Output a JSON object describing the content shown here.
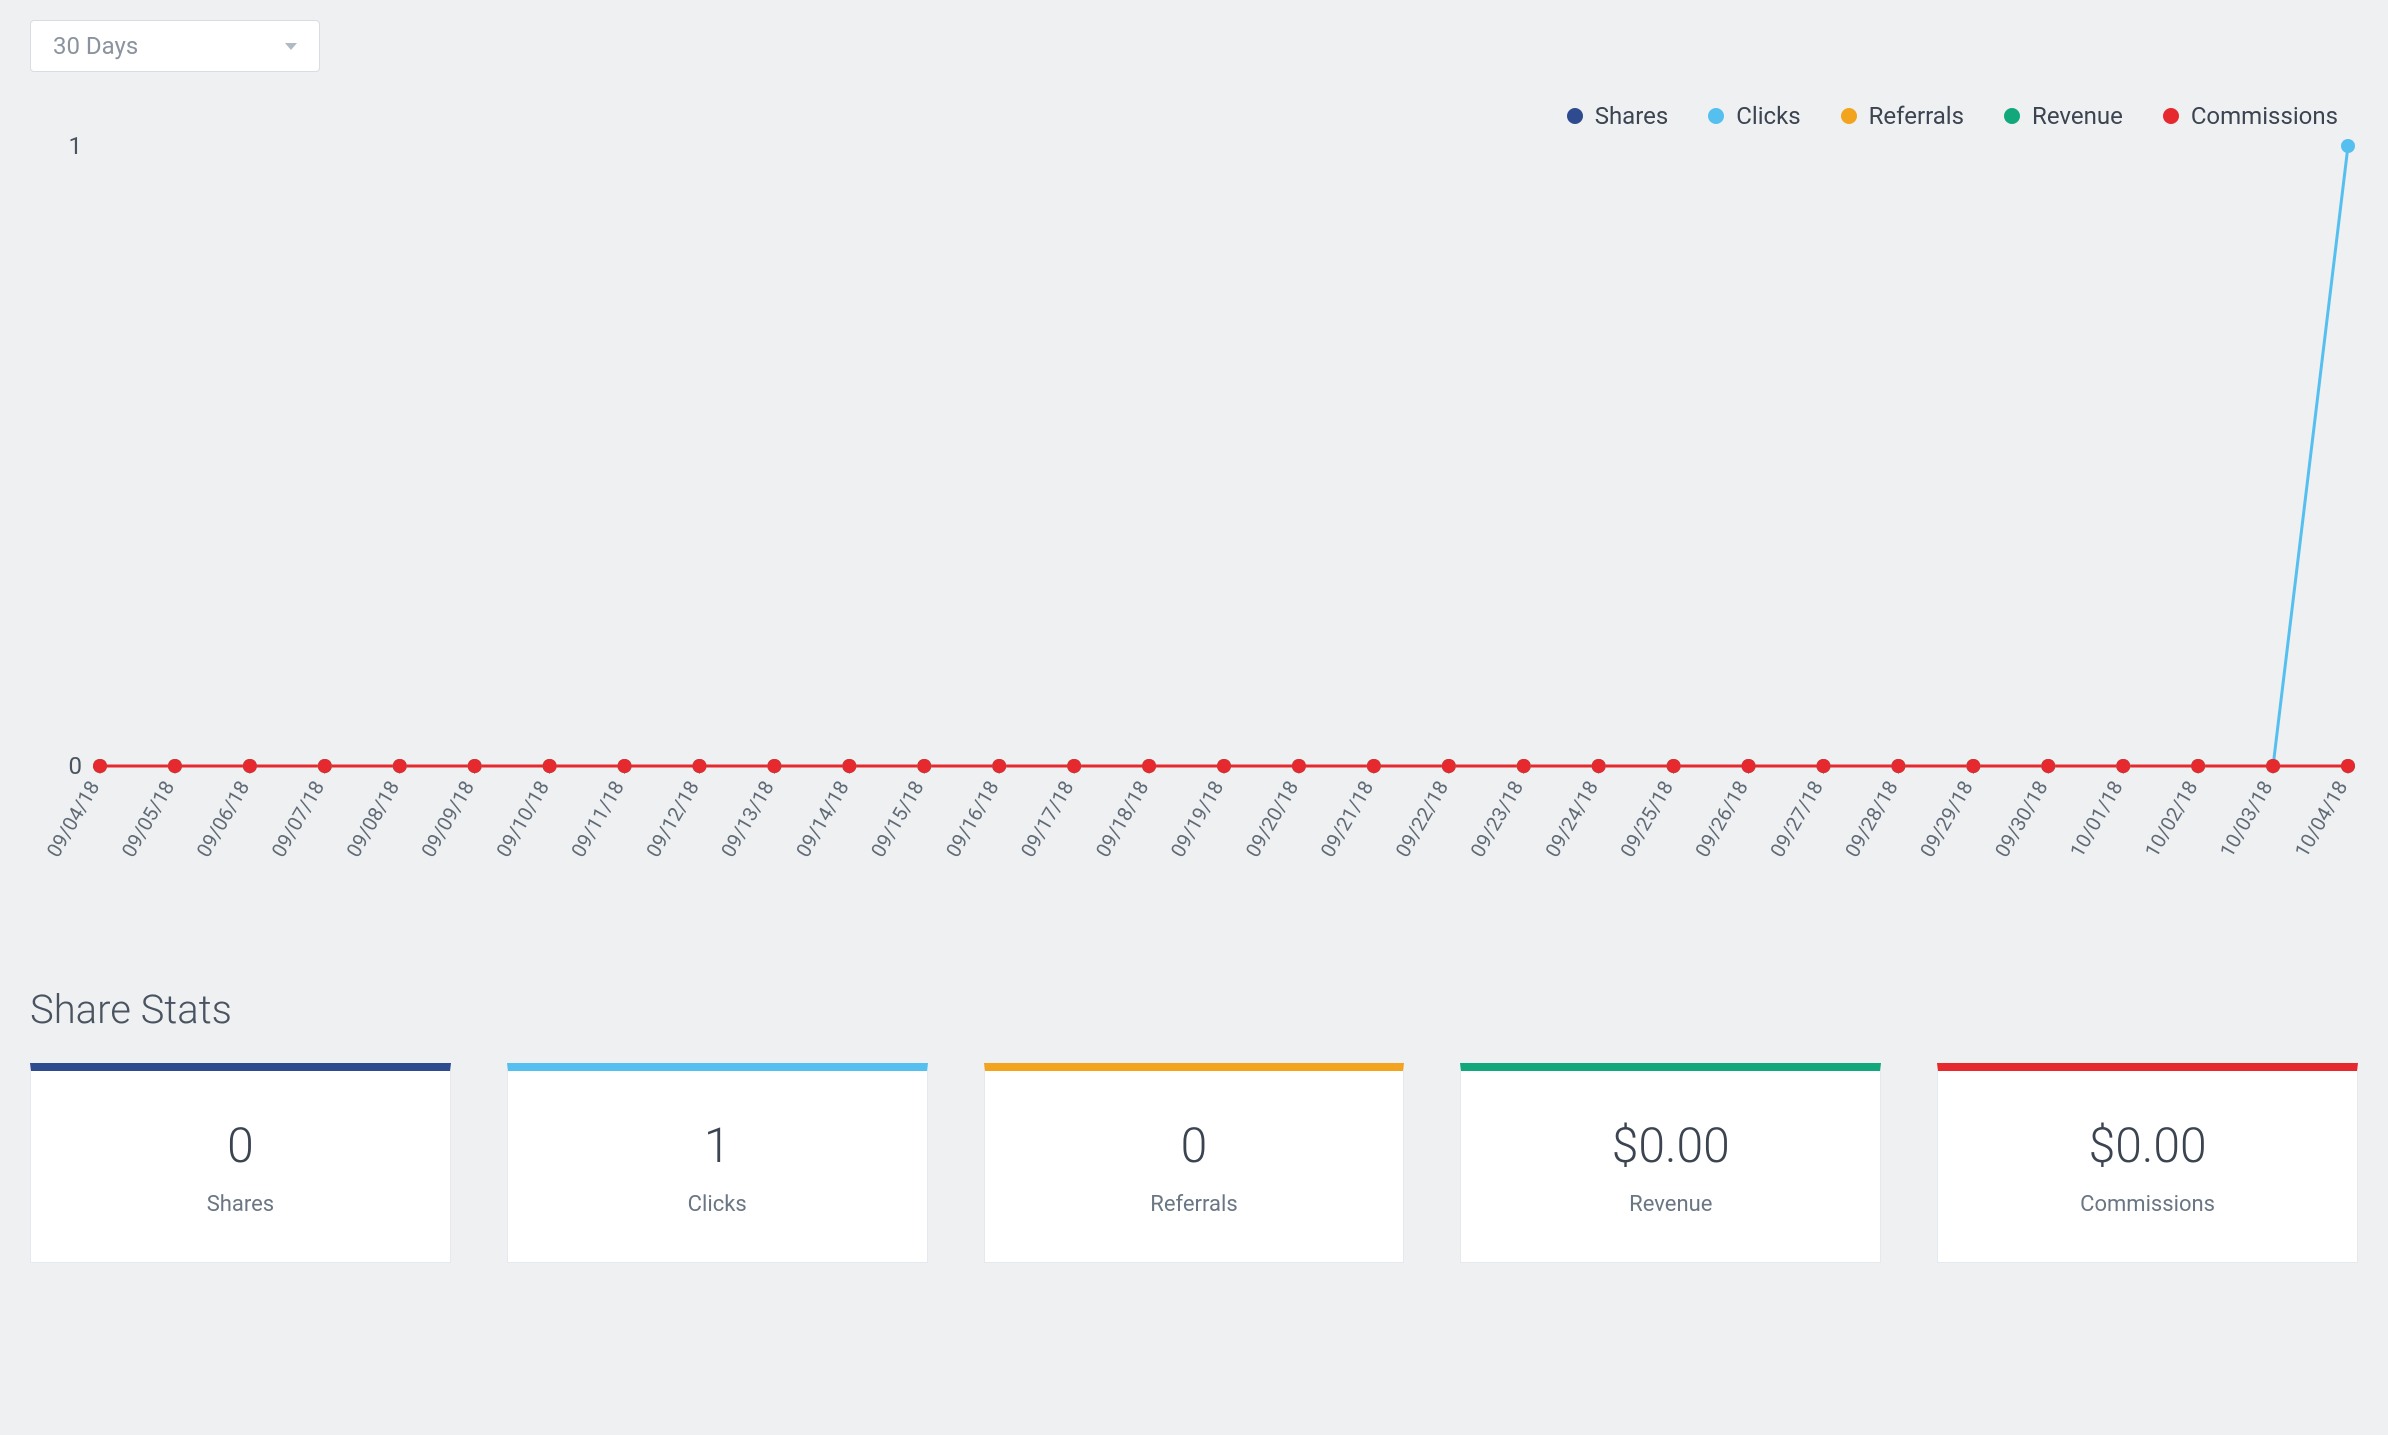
{
  "dropdown": {
    "selected": "30 Days"
  },
  "colors": {
    "shares": "#2f4b8f",
    "clicks": "#55bff0",
    "referrals": "#f2a41f",
    "revenue": "#12a87b",
    "commissions": "#e6292f"
  },
  "chart_data": {
    "type": "line",
    "xlabel": "",
    "ylabel": "",
    "ylim": [
      0,
      1
    ],
    "yticks": [
      0,
      1
    ],
    "categories": [
      "09/04/18",
      "09/05/18",
      "09/06/18",
      "09/07/18",
      "09/08/18",
      "09/09/18",
      "09/10/18",
      "09/11/18",
      "09/12/18",
      "09/13/18",
      "09/14/18",
      "09/15/18",
      "09/16/18",
      "09/17/18",
      "09/18/18",
      "09/19/18",
      "09/20/18",
      "09/21/18",
      "09/22/18",
      "09/23/18",
      "09/24/18",
      "09/25/18",
      "09/26/18",
      "09/27/18",
      "09/28/18",
      "09/29/18",
      "09/30/18",
      "10/01/18",
      "10/02/18",
      "10/03/18",
      "10/04/18"
    ],
    "series": [
      {
        "name": "Shares",
        "colorKey": "shares",
        "values": [
          0,
          0,
          0,
          0,
          0,
          0,
          0,
          0,
          0,
          0,
          0,
          0,
          0,
          0,
          0,
          0,
          0,
          0,
          0,
          0,
          0,
          0,
          0,
          0,
          0,
          0,
          0,
          0,
          0,
          0,
          0
        ]
      },
      {
        "name": "Clicks",
        "colorKey": "clicks",
        "values": [
          0,
          0,
          0,
          0,
          0,
          0,
          0,
          0,
          0,
          0,
          0,
          0,
          0,
          0,
          0,
          0,
          0,
          0,
          0,
          0,
          0,
          0,
          0,
          0,
          0,
          0,
          0,
          0,
          0,
          0,
          1
        ]
      },
      {
        "name": "Referrals",
        "colorKey": "referrals",
        "values": [
          0,
          0,
          0,
          0,
          0,
          0,
          0,
          0,
          0,
          0,
          0,
          0,
          0,
          0,
          0,
          0,
          0,
          0,
          0,
          0,
          0,
          0,
          0,
          0,
          0,
          0,
          0,
          0,
          0,
          0,
          0
        ]
      },
      {
        "name": "Revenue",
        "colorKey": "revenue",
        "values": [
          0,
          0,
          0,
          0,
          0,
          0,
          0,
          0,
          0,
          0,
          0,
          0,
          0,
          0,
          0,
          0,
          0,
          0,
          0,
          0,
          0,
          0,
          0,
          0,
          0,
          0,
          0,
          0,
          0,
          0,
          0
        ]
      },
      {
        "name": "Commissions",
        "colorKey": "commissions",
        "values": [
          0,
          0,
          0,
          0,
          0,
          0,
          0,
          0,
          0,
          0,
          0,
          0,
          0,
          0,
          0,
          0,
          0,
          0,
          0,
          0,
          0,
          0,
          0,
          0,
          0,
          0,
          0,
          0,
          0,
          0,
          0
        ]
      }
    ],
    "legend_position": "top-right",
    "grid": false
  },
  "stats": {
    "title": "Share Stats",
    "cards": [
      {
        "value": "0",
        "label": "Shares",
        "accentKey": "shares"
      },
      {
        "value": "1",
        "label": "Clicks",
        "accentKey": "clicks"
      },
      {
        "value": "0",
        "label": "Referrals",
        "accentKey": "referrals"
      },
      {
        "value": "$0.00",
        "label": "Revenue",
        "accentKey": "revenue"
      },
      {
        "value": "$0.00",
        "label": "Commissions",
        "accentKey": "commissions"
      }
    ]
  }
}
